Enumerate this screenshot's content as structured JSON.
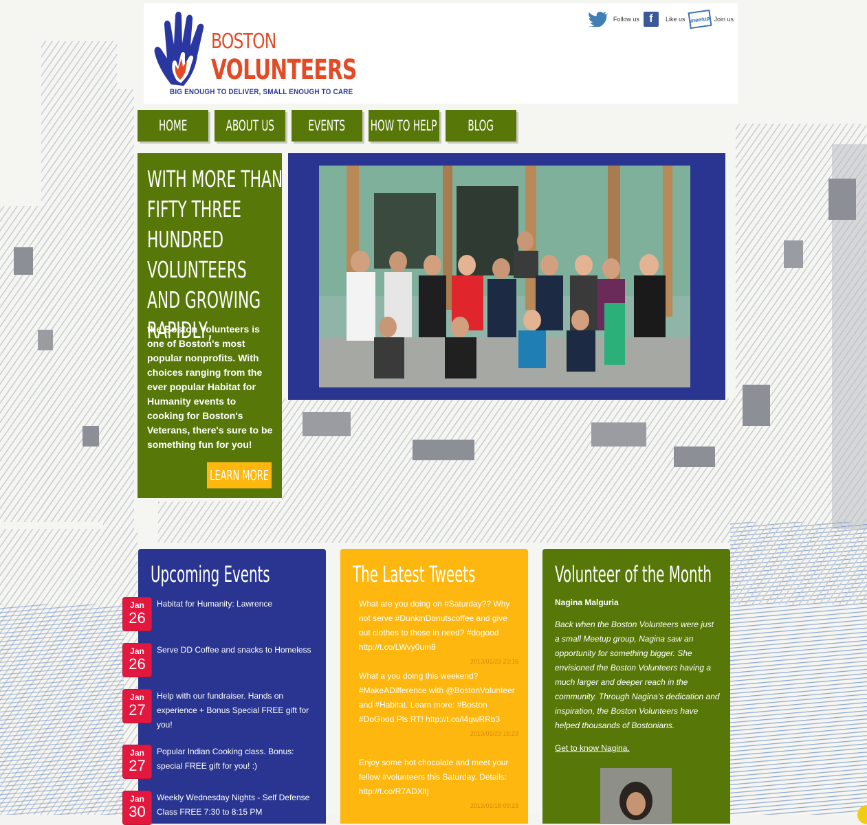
{
  "header": {
    "logo": {
      "name_line1": "BOSTON",
      "name_line2": "VOLUNTEERS",
      "tagline": "BIG ENOUGH TO DELIVER, SMALL ENOUGH TO CARE"
    },
    "social": [
      {
        "icon": "twitter-icon",
        "label": "Follow us"
      },
      {
        "icon": "facebook-icon",
        "label": "Like us"
      },
      {
        "icon": "meetup-icon",
        "label": "Join us"
      }
    ]
  },
  "nav": {
    "items": [
      "HOME",
      "ABOUT US",
      "EVENTS",
      "HOW TO HELP",
      "BLOG"
    ]
  },
  "promo": {
    "headline": "With more than fifty three hundred volunteers and growing rapidly,",
    "body": "the Boston Volunteers is one of Boston's most popular nonprofits. With choices ranging from the ever popular Habitat for Humanity events to cooking for Boston's Veterans, there's sure to be something fun for you!",
    "button": "LEARN MORE"
  },
  "events": {
    "title": "Upcoming Events",
    "items": [
      {
        "month": "Jan",
        "day": "26",
        "title": "Habitat for Humanity: Lawrence"
      },
      {
        "month": "Jan",
        "day": "26",
        "title": "Serve DD Coffee and snacks to Homeless"
      },
      {
        "month": "Jan",
        "day": "27",
        "title": "Help with our fundraiser. Hands on experience + Bonus Special FREE gift for you!"
      },
      {
        "month": "Jan",
        "day": "27",
        "title": "Popular Indian Cooking class. Bonus: special FREE gift for you! :)"
      },
      {
        "month": "Jan",
        "day": "30",
        "title": "Weekly Wednesday Nights - Self Defense Class FREE 7:30 to 8:15 PM"
      }
    ]
  },
  "tweets": {
    "title": "The Latest Tweets",
    "items": [
      {
        "text": "What are you doing on #Saturday?? Why not serve #DunkinDonutscoffee and give out clothes to those in need? #dogood http://t.co/LWvy0um8",
        "time": "2013/01/23 23:16"
      },
      {
        "text": "What a you doing this weekend? #MakeADifference with @BostonVolunteer and #Habitat. Learn more: #Boston #DoGood Pls RT! http://t.co/l4gwRRb3",
        "time": "2013/01/23 15:23"
      },
      {
        "text": "Enjoy some hot chocolate and meet your fellow #volunteers this Saturday. Details: http://t.co/R7ADXltj",
        "time": "2013/01/18 09:23"
      }
    ]
  },
  "votm": {
    "title": "Volunteer of the Month",
    "name": "Nagina Malguria",
    "body": "Back when the Boston Volunteers were just a small Meetup group, Nagina saw an opportunity for something bigger. She envisioned the Boston Volunteers having a much larger and deeper reach in the community. Through Nagina's dedication and inspiration, the Boston Volunteers have helped thousands of Bostonians.",
    "link": "Get to know Nagina."
  },
  "colors": {
    "green": "#577708",
    "blue": "#293590",
    "yellow": "#fdb70f",
    "red": "#e3183f",
    "logo_orange": "#e34b26"
  }
}
